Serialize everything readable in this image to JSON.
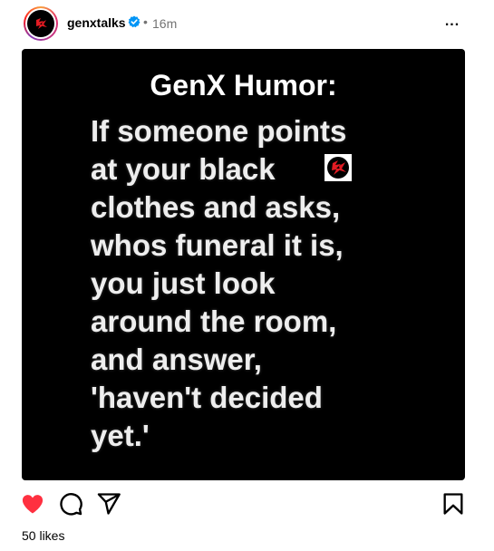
{
  "header": {
    "username": "genxtalks",
    "separator": "•",
    "time": "16m",
    "more_label": "..."
  },
  "post": {
    "image_title": "GenX Humor:",
    "image_lines": [
      "If someone points",
      "at your black",
      "clothes and asks,",
      "whos funeral it is,",
      "you just look",
      "around the room,",
      "and answer,",
      "'haven't decided",
      "yet.'"
    ]
  },
  "actions": {
    "liked": true,
    "like_color": "#ff3040"
  },
  "likes_text": "50 likes",
  "colors": {
    "verified": "#0095f6",
    "accent": "#ff3040"
  }
}
